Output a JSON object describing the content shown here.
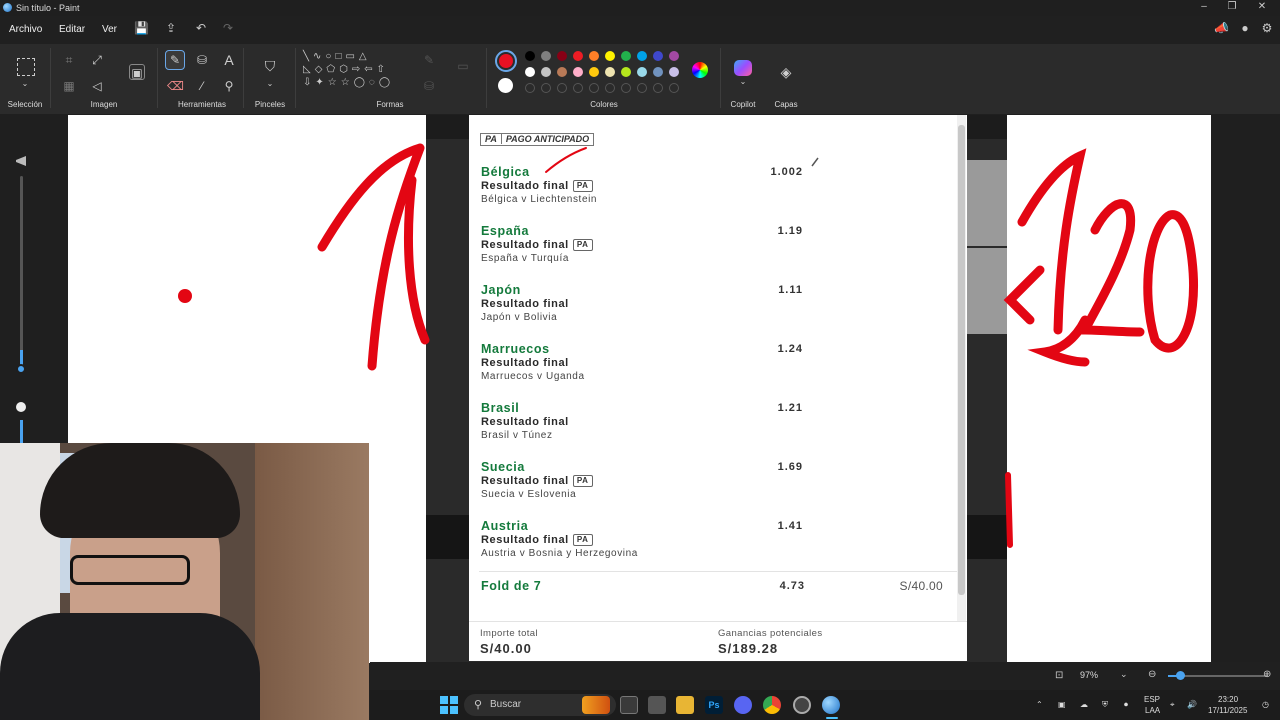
{
  "window": {
    "title": "Sin título - Paint"
  },
  "menu": {
    "file": "Archivo",
    "edit": "Editar",
    "view": "Ver"
  },
  "ribbon": {
    "groups": {
      "selection": "Selección",
      "image": "Imagen",
      "tools": "Herramientas",
      "brushes": "Pinceles",
      "shapes": "Formas",
      "colors": "Colores",
      "copilot": "Copilot",
      "layers": "Capas"
    },
    "tool_text": "A",
    "swatches_row1": [
      "#000000",
      "#7f7f7f",
      "#880015",
      "#ed1c24",
      "#ff7f27",
      "#fff200",
      "#22b14c",
      "#00a2e8",
      "#3f48cc",
      "#a349a4"
    ],
    "swatches_row2": [
      "#ffffff",
      "#c3c3c3",
      "#b97a57",
      "#ffaec9",
      "#ffc90e",
      "#efe4b0",
      "#b5e61d",
      "#99d9ea",
      "#7092be",
      "#c8bfe7"
    ],
    "primary_color": "#e81123",
    "secondary_color": "#ffffff"
  },
  "betslip": {
    "header_code": "PA",
    "header_label": "PAGO ANTICIPADO",
    "pa_badge": "PA",
    "selections": [
      {
        "team": "Bélgica",
        "market": "Resultado final",
        "pa": true,
        "match": "Bélgica v Liechtenstein",
        "odds": "1.002"
      },
      {
        "team": "España",
        "market": "Resultado final",
        "pa": true,
        "match": "España v Turquía",
        "odds": "1.19"
      },
      {
        "team": "Japón",
        "market": "Resultado final",
        "pa": false,
        "match": "Japón v Bolivia",
        "odds": "1.11"
      },
      {
        "team": "Marruecos",
        "market": "Resultado final",
        "pa": false,
        "match": "Marruecos v Uganda",
        "odds": "1.24"
      },
      {
        "team": "Brasil",
        "market": "Resultado final",
        "pa": false,
        "match": "Brasil v Túnez",
        "odds": "1.21"
      },
      {
        "team": "Suecia",
        "market": "Resultado final",
        "pa": true,
        "match": "Suecia v Eslovenia",
        "odds": "1.69"
      },
      {
        "team": "Austria",
        "market": "Resultado final",
        "pa": true,
        "match": "Austria v Bosnia y Herzegovina",
        "odds": "1.41"
      }
    ],
    "fold_label": "Fold de 7",
    "fold_odds": "4.73",
    "fold_stake": "S/40.00",
    "total_stake_label": "Importe total",
    "total_stake": "S/40.00",
    "potential_label": "Ganancias potenciales",
    "potential_value": "S/189.28"
  },
  "statusbar": {
    "zoom": "97%"
  },
  "taskbar": {
    "search_placeholder": "Buscar",
    "lang_top": "ESP",
    "lang_bottom": "LAA",
    "time": "23:20",
    "date": "17/11/2025"
  },
  "colors": {
    "accent": "#147a3c",
    "ink": "#e30613"
  }
}
